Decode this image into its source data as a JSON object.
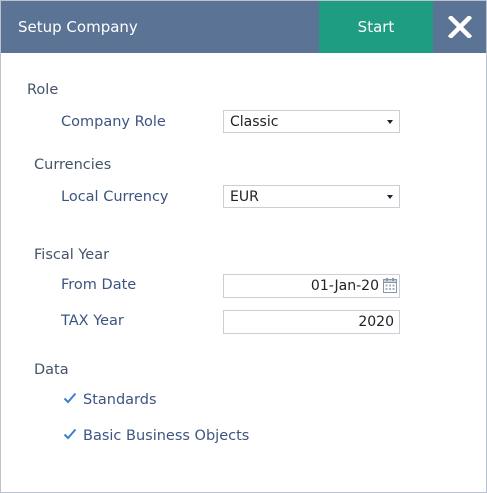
{
  "header": {
    "title": "Setup Company",
    "start_label": "Start"
  },
  "role": {
    "heading": "Role",
    "company_role_label": "Company Role",
    "company_role_value": "Classic"
  },
  "currencies": {
    "heading": "Currencies",
    "local_currency_label": "Local Currency",
    "local_currency_value": "EUR"
  },
  "fiscal_year": {
    "heading": "Fiscal Year",
    "from_date_label": "From Date",
    "from_date_value": "01-Jan-20",
    "tax_year_label": "TAX Year",
    "tax_year_value": "2020"
  },
  "data_section": {
    "heading": "Data",
    "items": [
      {
        "label": "Standards",
        "checked": true
      },
      {
        "label": "Basic Business Objects",
        "checked": true
      }
    ]
  },
  "colors": {
    "header_bg": "#5b7395",
    "start_bg": "#1f9d82",
    "label_text": "#3c5580",
    "check_color": "#3c7fd0"
  },
  "icons": [
    "close-icon",
    "calendar-icon",
    "chevron-down-icon",
    "checkmark-icon"
  ]
}
